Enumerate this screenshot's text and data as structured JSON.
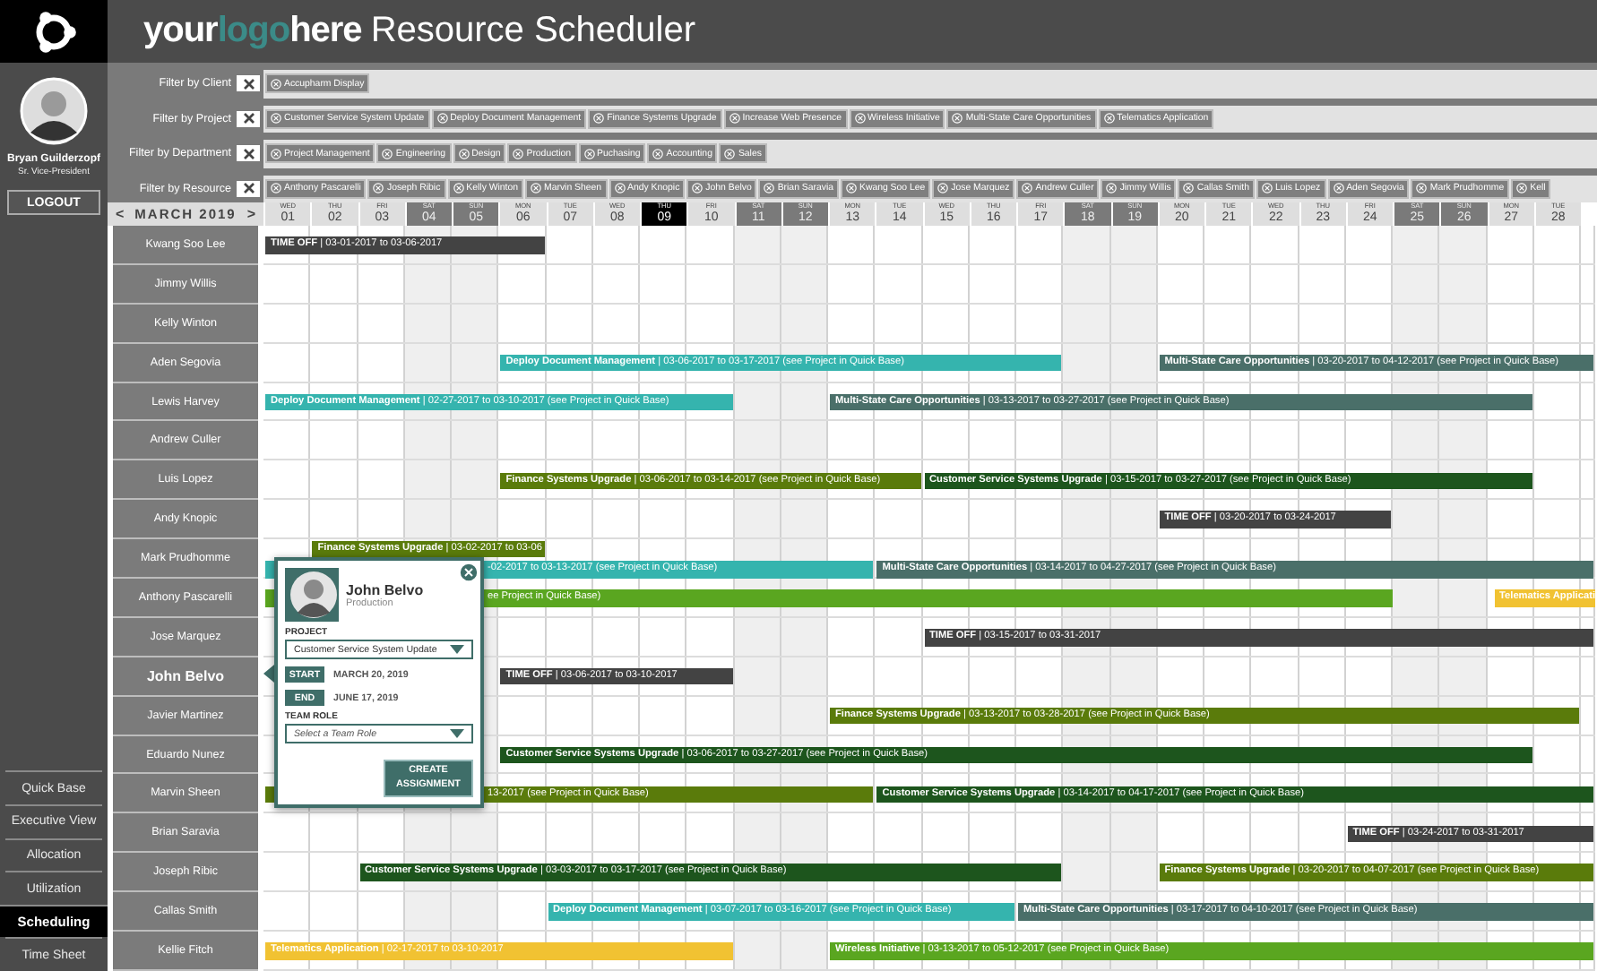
{
  "header": {
    "logo_parts": [
      {
        "text": "your",
        "kind": "plain"
      },
      {
        "text": "logo",
        "kind": "accent"
      },
      {
        "text": "here",
        "kind": "plain"
      }
    ],
    "title": "Resource Scheduler"
  },
  "user": {
    "name": "Bryan Guilderzopf",
    "role": "Sr. Vice-President",
    "logout": "LOGOUT"
  },
  "nav": [
    {
      "label": "Quick Base",
      "selected": false
    },
    {
      "label": "Executive View",
      "selected": false
    },
    {
      "label": "Allocation",
      "selected": false
    },
    {
      "label": "Utilization",
      "selected": false
    },
    {
      "label": "Scheduling",
      "selected": true
    },
    {
      "label": "Time Sheet",
      "selected": false
    }
  ],
  "filters": [
    {
      "label": "Filter by Client",
      "chips": [
        "Accupharm Display"
      ]
    },
    {
      "label": "Filter by Project",
      "chips": [
        "Customer Service System Update",
        "Deploy Document Management",
        "Finance Systems Upgrade",
        "Increase Web Presence",
        "Wireless Initiative",
        "Multi-State Care Opportunities",
        "Telematics Application"
      ]
    },
    {
      "label": "Filter by Department",
      "chips": [
        "Project Management",
        "Engineering",
        "Design",
        "Production",
        "Puchasing",
        "Accounting",
        "Sales"
      ]
    },
    {
      "label": "Filter by Resource",
      "chips": [
        "Anthony Pascarelli",
        "Joseph Ribic",
        "Kelly Winton",
        "Marvin Sheen",
        "Andy Knopic",
        "John Belvo",
        "Brian Saravia",
        "Kwang Soo Lee",
        "Jose Marquez",
        "Andrew Culler",
        "Jimmy Willis",
        "Callas Smith",
        "Luis Lopez",
        "Aden Segovia",
        "Mark Prudhomme",
        "Kell"
      ]
    }
  ],
  "calendar": {
    "prev": "<",
    "month": "MARCH 2019",
    "next": ">",
    "days": [
      {
        "weekday": "WED",
        "day": "01",
        "weekend": false,
        "selected": false
      },
      {
        "weekday": "THU",
        "day": "02",
        "weekend": false,
        "selected": false
      },
      {
        "weekday": "FRI",
        "day": "03",
        "weekend": false,
        "selected": false
      },
      {
        "weekday": "SAT",
        "day": "04",
        "weekend": true,
        "selected": false
      },
      {
        "weekday": "SUN",
        "day": "05",
        "weekend": true,
        "selected": false
      },
      {
        "weekday": "MON",
        "day": "06",
        "weekend": false,
        "selected": false
      },
      {
        "weekday": "TUE",
        "day": "07",
        "weekend": false,
        "selected": false
      },
      {
        "weekday": "WED",
        "day": "08",
        "weekend": false,
        "selected": false
      },
      {
        "weekday": "THU",
        "day": "09",
        "weekend": false,
        "selected": true
      },
      {
        "weekday": "FRI",
        "day": "10",
        "weekend": false,
        "selected": false
      },
      {
        "weekday": "SAT",
        "day": "11",
        "weekend": true,
        "selected": false
      },
      {
        "weekday": "SUN",
        "day": "12",
        "weekend": true,
        "selected": false
      },
      {
        "weekday": "MON",
        "day": "13",
        "weekend": false,
        "selected": false
      },
      {
        "weekday": "TUE",
        "day": "14",
        "weekend": false,
        "selected": false
      },
      {
        "weekday": "WED",
        "day": "15",
        "weekend": false,
        "selected": false
      },
      {
        "weekday": "THU",
        "day": "16",
        "weekend": false,
        "selected": false
      },
      {
        "weekday": "FRI",
        "day": "17",
        "weekend": false,
        "selected": false
      },
      {
        "weekday": "SAT",
        "day": "18",
        "weekend": true,
        "selected": false
      },
      {
        "weekday": "SUN",
        "day": "19",
        "weekend": true,
        "selected": false
      },
      {
        "weekday": "MON",
        "day": "20",
        "weekend": false,
        "selected": false
      },
      {
        "weekday": "TUE",
        "day": "21",
        "weekend": false,
        "selected": false
      },
      {
        "weekday": "WED",
        "day": "22",
        "weekend": false,
        "selected": false
      },
      {
        "weekday": "THU",
        "day": "23",
        "weekend": false,
        "selected": false
      },
      {
        "weekday": "FRI",
        "day": "24",
        "weekend": false,
        "selected": false
      },
      {
        "weekday": "SAT",
        "day": "25",
        "weekend": true,
        "selected": false
      },
      {
        "weekday": "SUN",
        "day": "26",
        "weekend": true,
        "selected": false
      },
      {
        "weekday": "MON",
        "day": "27",
        "weekend": false,
        "selected": false
      },
      {
        "weekday": "TUE",
        "day": "28",
        "weekend": false,
        "selected": false
      }
    ]
  },
  "resources": [
    {
      "name": "Kwang Soo Lee",
      "selected": false,
      "lanes": [
        [
          {
            "label": "**TIME OFF** | 03-01-2017 to 03-06-2017",
            "color": "#434343",
            "covered": false
          }
        ]
      ]
    },
    {
      "name": "Jimmy Willis",
      "selected": false
    },
    {
      "name": "Kelly Winton",
      "selected": false
    },
    {
      "name": "Aden Segovia",
      "selected": false,
      "lanes": [
        [
          {
            "label": "**Deploy Document Management** | 03-06-2017 to 03-17-2017 (see Project in Quick Base)",
            "color": "#35b4ae",
            "covered": false
          },
          {
            "label": "**Multi-State Care Opportunities** | 03-20-2017 to 04-12-2017 (see Project in Quick Base)",
            "color": "#4a6f69",
            "covered": false
          }
        ]
      ]
    },
    {
      "name": "Lewis Harvey",
      "selected": false,
      "lanes": [
        [
          {
            "label": "**Deploy Document Management** | 02-27-2017 to 03-10-2017 (see Project in Quick Base)",
            "color": "#35b4ae",
            "covered": false
          },
          {
            "label": "**Multi-State Care Opportunities** | 03-13-2017 to 03-27-2017 (see Project in Quick Base)",
            "color": "#4a6f69",
            "covered": false
          }
        ]
      ]
    },
    {
      "name": "Andrew Culler",
      "selected": false
    },
    {
      "name": "Luis Lopez",
      "selected": false,
      "lanes": [
        [
          {
            "label": "**Finance Systems Upgrade** | 03-06-2017 to 03-14-2017 (see Project in Quick Base)",
            "color": "#5a7b0b",
            "covered": false
          },
          {
            "label": "**Customer Service Systems Upgrade** | 03-15-2017 to 03-27-2017 (see Project in Quick Base)",
            "color": "#1d551d",
            "covered": false
          }
        ]
      ]
    },
    {
      "name": "Andy Knopic",
      "selected": false,
      "lanes": [
        [
          {
            "label": "**TIME OFF** | 03-20-2017 to 03-24-2017",
            "color": "#434343",
            "covered": false
          }
        ]
      ]
    },
    {
      "name": "Mark Prudhomme",
      "selected": false,
      "lanes": [
        [
          {
            "label": "**Finance Systems Upgrade** | 03-02-2017 to 03-06",
            "color": "#5a7b0b",
            "covered": false
          }
        ],
        [
          {
            "label": "-02-2017 to 03-13-2017 (see Project in Quick Base)",
            "color": "#35b4ae",
            "covered": true
          },
          {
            "label": "**Multi-State Care Opportunities** | 03-14-2017 to 04-27-2017 (see Project in Quick Base)",
            "color": "#4a6f69",
            "covered": false
          }
        ]
      ]
    },
    {
      "name": "Anthony Pascarelli",
      "selected": false,
      "lanes": [
        [
          {
            "label": "ee Project in Quick Base)",
            "color": "#5aa620",
            "covered": true
          },
          {
            "label": "**Telematics Applicati**",
            "color": "#f1c232",
            "covered": false
          }
        ]
      ]
    },
    {
      "name": "Jose Marquez",
      "selected": false,
      "lanes": [
        [
          {
            "label": "**TIME OFF** | 03-15-2017 to 03-31-2017",
            "color": "#434343",
            "covered": false
          }
        ]
      ]
    },
    {
      "name": "John Belvo",
      "selected": true,
      "lanes": [
        [
          {
            "label": "**TIME OFF** | 03-06-2017 to 03-10-2017",
            "color": "#434343",
            "covered": false
          }
        ]
      ]
    },
    {
      "name": "Javier Martinez",
      "selected": false,
      "lanes": [
        [
          {
            "label": "**Finance Systems Upgrade** | 03-13-2017 to 03-28-2017 (see Project in Quick Base)",
            "color": "#5a7b0b",
            "covered": false
          }
        ]
      ]
    },
    {
      "name": "Eduardo Nunez",
      "selected": false,
      "lanes": [
        [
          {
            "label": "**Customer Service Systems Upgrade** | 03-06-2017 to 03-27-2017 (see Project in Quick Base)",
            "color": "#1d551d",
            "covered": false
          }
        ]
      ]
    },
    {
      "name": "Marvin Sheen",
      "selected": false,
      "lanes": [
        [
          {
            "label": "13-2017 (see Project in Quick Base)",
            "color": "#5a7b0b",
            "covered": true
          },
          {
            "label": "**Customer Service Systems Upgrade** | 03-14-2017 to 04-17-2017 (see Project in Quick Base)",
            "color": "#1d551d",
            "covered": false
          }
        ]
      ]
    },
    {
      "name": "Brian Saravia",
      "selected": false,
      "lanes": [
        [
          {
            "label": "**TIME OFF** | 03-24-2017 to 03-31-2017",
            "color": "#434343",
            "covered": false
          }
        ]
      ]
    },
    {
      "name": "Joseph Ribic",
      "selected": false,
      "lanes": [
        [
          {
            "label": "**Customer Service Systems Upgrade** | 03-03-2017 to 03-17-2017 (see Project in Quick Base)",
            "color": "#1d551d",
            "covered": false
          },
          {
            "label": "**Finance Systems Upgrade** | 03-20-2017 to 04-07-2017 (see Project in Quick Base)",
            "color": "#5a7b0b",
            "covered": false
          }
        ]
      ]
    },
    {
      "name": "Callas Smith",
      "selected": false,
      "lanes": [
        [
          {
            "label": "**Deploy Document Management** | 03-07-2017 to 03-16-2017 (see Project in Quick Base)",
            "color": "#35b4ae",
            "covered": false
          },
          {
            "label": "**Multi-State Care Opportunities** | 03-17-2017 to 04-10-2017 (see Project in Quick Base)",
            "color": "#4a6f69",
            "covered": false
          }
        ]
      ]
    },
    {
      "name": "Kellie Fitch",
      "selected": false,
      "lanes": [
        [
          {
            "label": "**Telematics Application** | 02-17-2017 to 03-10-2017",
            "color": "#f1c232",
            "covered": false
          },
          {
            "label": "**Wireless Initiative** | 03-13-2017 to 05-12-2017 (see Project in Quick Base)",
            "color": "#5aa620",
            "covered": false
          }
        ]
      ]
    }
  ],
  "popup": {
    "name": "John Belvo",
    "department": "Production",
    "project_label": "PROJECT",
    "project": "Customer Service System Update",
    "start_tag": "START",
    "start": "MARCH 20, 2019",
    "end_tag": "END",
    "end": "JUNE 17, 2019",
    "role_label": "TEAM ROLE",
    "role_placeholder": "Select a Team Role",
    "button": "CREATE ASSIGNMENT"
  }
}
